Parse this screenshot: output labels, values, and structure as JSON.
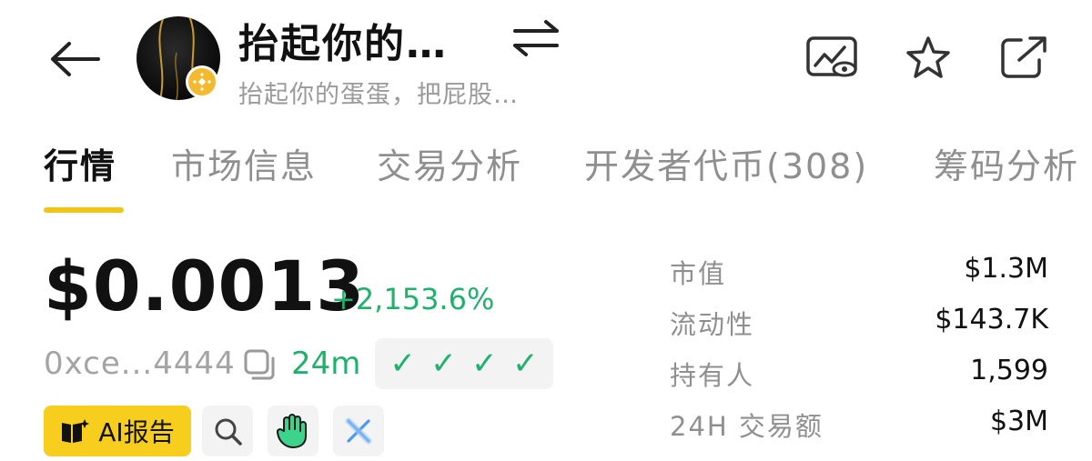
{
  "header": {
    "token_name": "抬起你的…",
    "token_subtitle": "抬起你的蛋蛋，把屁股…",
    "icons": {
      "back": "arrow-left-icon",
      "swap": "swap-arrows-icon",
      "watch": "chart-eye-icon",
      "favorite": "star-icon",
      "share": "share-external-icon",
      "chain": "bnb-chain-icon"
    }
  },
  "tabs": [
    {
      "label": "行情",
      "active": true
    },
    {
      "label": "市场信息",
      "active": false
    },
    {
      "label": "交易分析",
      "active": false
    },
    {
      "label": "开发者代币(308)",
      "active": false
    },
    {
      "label": "筹码分析",
      "active": false
    }
  ],
  "price": {
    "value": "$0.0013",
    "change": "+2,153.6%",
    "address": "0xce...4444",
    "age": "24m",
    "checks": [
      "✓",
      "✓",
      "✓",
      "✓"
    ]
  },
  "actions": {
    "ai_report": "AI报告",
    "icons": [
      "search-icon",
      "hand-wave-icon",
      "x-logo-icon"
    ]
  },
  "stats": [
    {
      "label": "市值",
      "value": "$1.3M"
    },
    {
      "label": "流动性",
      "value": "$143.7K"
    },
    {
      "label": "持有人",
      "value": "1,599"
    },
    {
      "label": "24H 交易额",
      "value": "$3M"
    }
  ],
  "colors": {
    "accent_yellow": "#F0C51A",
    "positive_green": "#20B26C",
    "muted_gray": "#8f8f8f"
  }
}
